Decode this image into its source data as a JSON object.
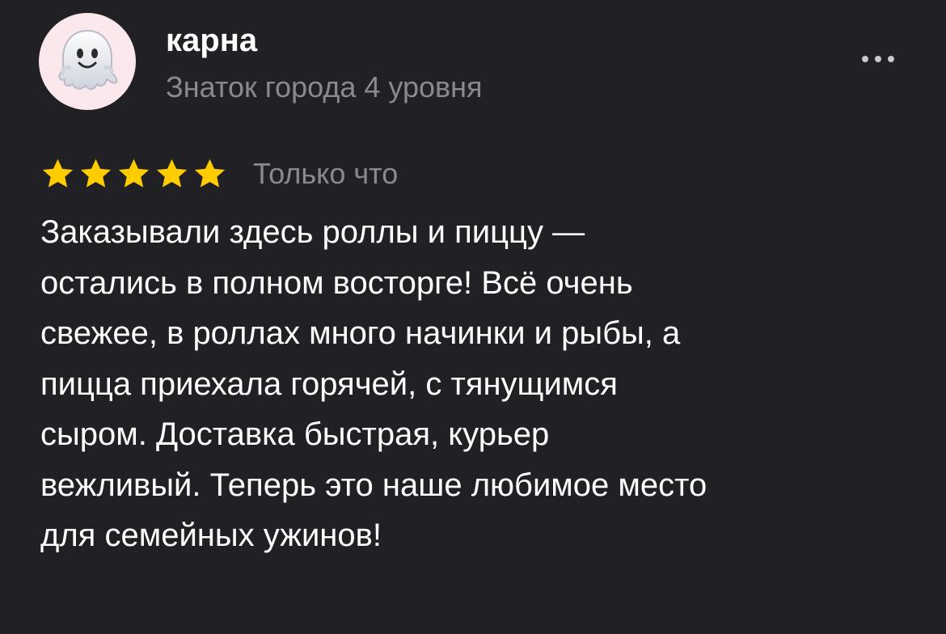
{
  "author": {
    "name": "карна",
    "level": "Знаток города 4 уровня",
    "avatar_icon": "ghost-emoji"
  },
  "menu": {
    "icon": "more-dots-icon"
  },
  "review": {
    "rating": 5,
    "rating_max": 5,
    "star_color": "#ffcc00",
    "time": "Только что",
    "text": "Заказывали здесь роллы и пиццу —\nостались в полном восторге! Всё очень\nсвежее, в роллах много начинки и рыбы, а\nпицца приехала горячей, с тянущимся\nсыром. Доставка быстрая, курьер\nвежливый. Теперь это наше любимое место\nдля семейных ужинов!"
  },
  "colors": {
    "background": "#212125",
    "secondary_text": "#8a8a8e",
    "avatar_bg": "#fae8ec"
  }
}
